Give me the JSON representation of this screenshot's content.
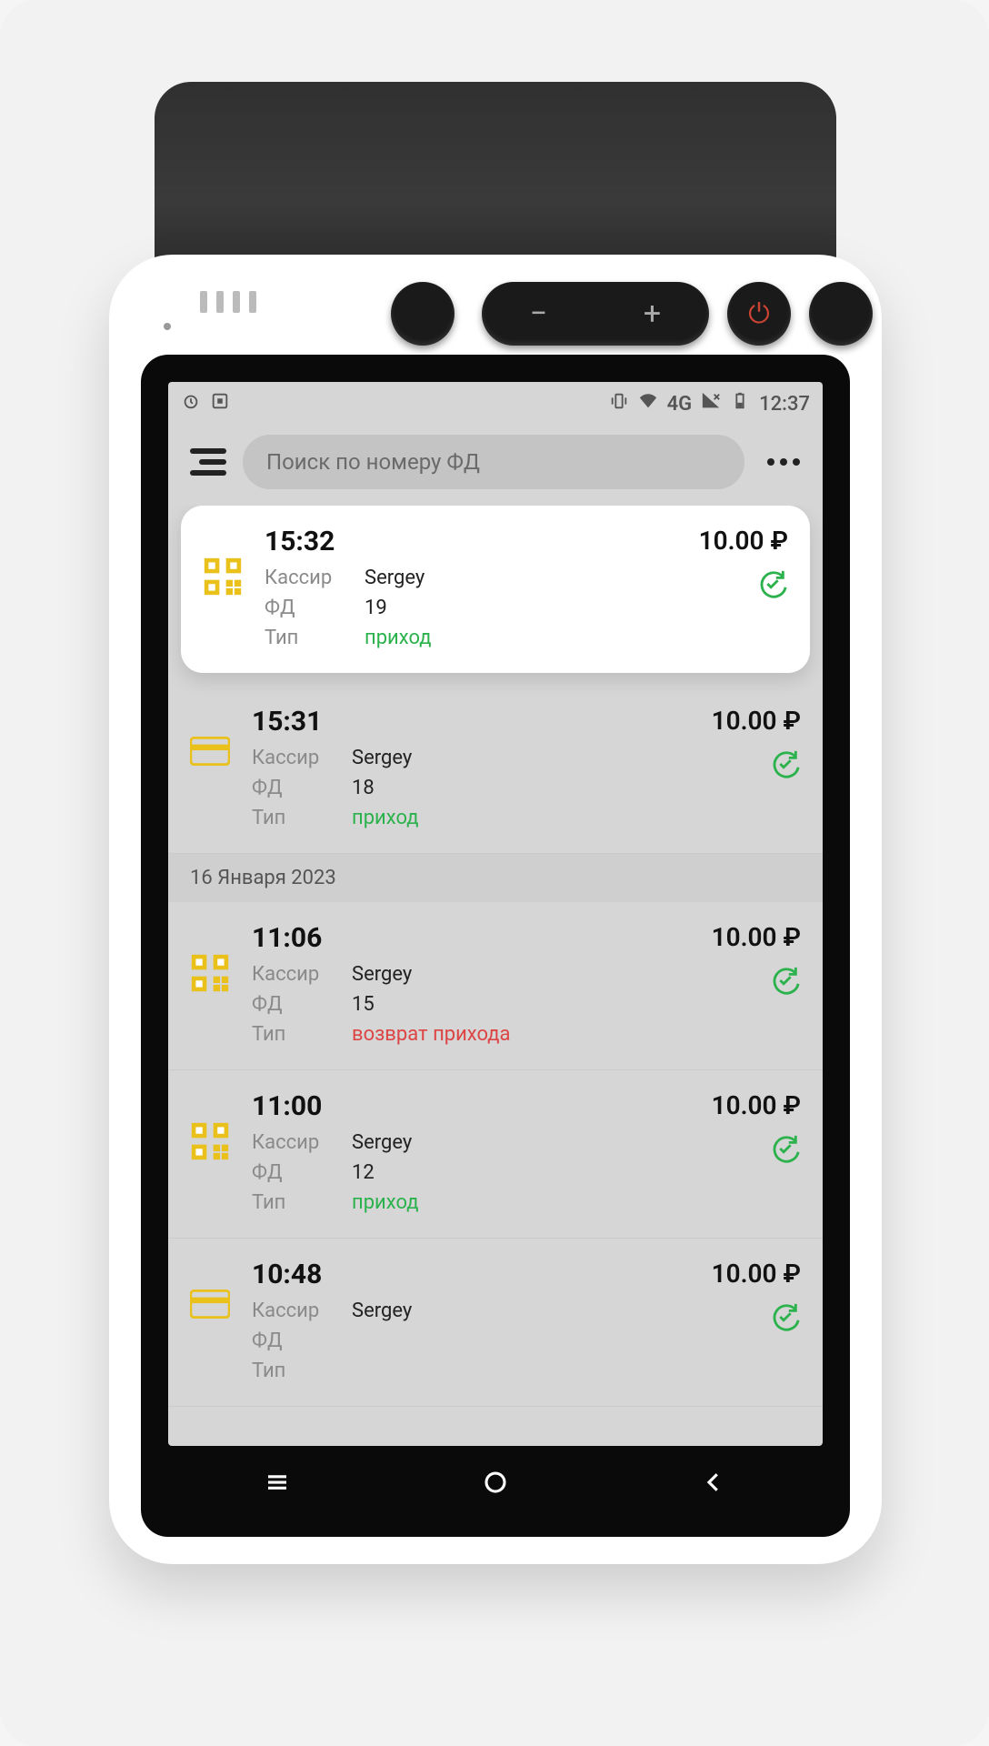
{
  "statusbar": {
    "network": "4G",
    "time": "12:37"
  },
  "header": {
    "search_placeholder": "Поиск по номеру ФД"
  },
  "labels": {
    "cashier": "Кассир",
    "fd": "ФД",
    "type": "Тип"
  },
  "sections": [
    {
      "header": null,
      "items": [
        {
          "time": "15:32",
          "cashier": "Sergey",
          "fd": "19",
          "type": "приход",
          "type_color": "green",
          "amount": "10.00 ₽",
          "icon": "qr",
          "highlighted": true
        },
        {
          "time": "15:31",
          "cashier": "Sergey",
          "fd": "18",
          "type": "приход",
          "type_color": "green",
          "amount": "10.00 ₽",
          "icon": "card",
          "highlighted": false
        }
      ]
    },
    {
      "header": "16 Января 2023",
      "items": [
        {
          "time": "11:06",
          "cashier": "Sergey",
          "fd": "15",
          "type": "возврат прихода",
          "type_color": "red",
          "amount": "10.00 ₽",
          "icon": "qr",
          "highlighted": false
        },
        {
          "time": "11:00",
          "cashier": "Sergey",
          "fd": "12",
          "type": "приход",
          "type_color": "green",
          "amount": "10.00 ₽",
          "icon": "qr",
          "highlighted": false
        },
        {
          "time": "10:48",
          "cashier": "Sergey",
          "fd": "",
          "type": "",
          "type_color": "green",
          "amount": "10.00 ₽",
          "icon": "card",
          "highlighted": false
        }
      ]
    }
  ]
}
